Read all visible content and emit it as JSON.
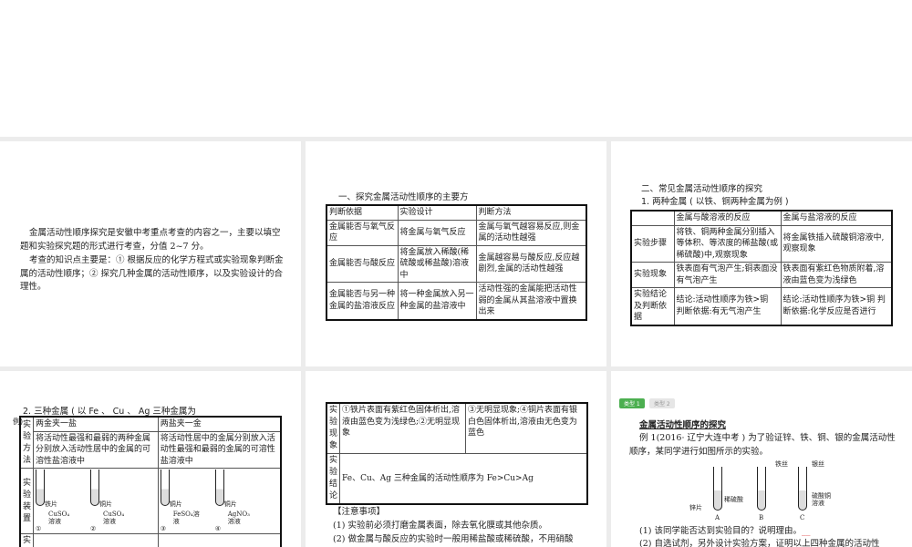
{
  "slide1": {
    "p1": "金属活动性顺序探究是安徽中考重点考查的内容之一，主要以填空题和实验探究题的形式进行考查，分值 2~7 分。",
    "p2": "考查的知识点主要是：① 根据反应的化学方程式或实验现象判断金属的活动性顺序；② 探究几种金属的活动性顺序，以及实验设计的合理性。"
  },
  "slide2": {
    "title": "一、探究金属活动性顺序的主要方",
    "headers": [
      "判断依据",
      "实验设计",
      "判断方法"
    ],
    "rows": [
      [
        "金属能否与氧气反应",
        "将金属与氧气反应",
        "金属与氧气越容易反应,则金属的活动性越强"
      ],
      [
        "金属能否与酸反应",
        "将金属放入稀酸(稀硫酸或稀盐酸)溶液中",
        "金属越容易与酸反应,反应越剧烈,金属的活动性越强"
      ],
      [
        "金属能否与另一种金属的盐溶液反应",
        "将一种金属放入另一种金属的盐溶液中",
        "活动性强的金属能把活动性弱的金属从其盐溶液中置换出来"
      ]
    ]
  },
  "slide3": {
    "title": "二、常见金属活动性顺序的探究",
    "subtitle": "1. 两种金属 ( 以铁、铜两种金属为例 )",
    "headers": [
      "",
      "金属与酸溶液的反应",
      "金属与盐溶液的反应"
    ],
    "rows": [
      [
        "实验步骤",
        "将铁、铜两种金属分别插入等体积、等浓度的稀盐酸(或稀硫酸)中,观察现象",
        "将金属铁插入硫酸铜溶液中,观察现象"
      ],
      [
        "实验现象",
        "铁表面有气泡产生;铜表面没有气泡产生",
        "铁表面有紫红色物质附着,溶液由蓝色变为浅绿色"
      ],
      [
        "实验结论及判断依据",
        "结论:活动性顺序为铁>铜 判断依据:有无气泡产生",
        "结论:活动性顺序为铁>铜 判断依据:化学反应是否进行"
      ]
    ]
  },
  "slide4": {
    "title": "2. 三种金属 ( 以 Fe 、 Cu 、 Ag 三种金属为",
    "title_cont": "例)",
    "method_label": "实验方法",
    "device_label": "实验装置",
    "result_label": "实",
    "col1_head": "两金夹一盐",
    "col2_head": "两盐夹一金",
    "col1_method": "将活动性最强和最弱的两种金属分别放入活动性居中的金属的可溶性盐溶液中",
    "col2_method": "将活动性居中的金属分别放入活动性最强和最弱的金属的可溶性盐溶液中",
    "tubes": [
      {
        "metal": "铁片",
        "solution": "CuSO₄溶液",
        "num": "①"
      },
      {
        "metal": "铜片",
        "solution": "CuSO₄溶液",
        "num": "②"
      },
      {
        "metal": "铜片",
        "solution": "FeSO₄溶液",
        "num": "③"
      },
      {
        "metal": "铜片",
        "solution": "AgNO₃溶液",
        "num": "④"
      }
    ]
  },
  "slide5": {
    "phen_label": "实验现象",
    "phen1": "①铁片表面有紫红色固体析出,溶液由蓝色变为浅绿色;②无明显现象",
    "phen2": "③无明显现象;④铜片表面有银白色固体析出,溶液由无色变为蓝色",
    "concl_label": "实验结论",
    "concl": "Fe、Cu、Ag 三种金属的活动性顺序为 Fe>Cu>Ag",
    "note_title": "【注意事项】",
    "note1": "(1) 实验前必须打磨金属表面，除去氧化膜或其他杂质。",
    "note2": "(2) 做金属与酸反应的实验时一般用稀盐酸或稀硫酸，不用硝酸"
  },
  "slide6": {
    "tab1": "类型 1",
    "tab2": "类型 2",
    "heading": "金属活动性顺序的探究",
    "example": "例 1(2016· 辽宁大连中考 ) 为了验证锌、铁、铜、银的金属活动性顺序，某同学进行如图所示的实验。",
    "labels": {
      "zinc": "锌片",
      "acid": "稀硫酸",
      "iron": "铁丝",
      "silver": "银丝",
      "cuso4": "硫酸铜溶液",
      "A": "A",
      "B": "B",
      "C": "C"
    },
    "q1": "(1) 该同学能否达到实验目的？说明理由。",
    "q1_blank": "__",
    "q2": "(2) 自选试剂，另外设计实验方案，证明以上四种金属的活动性"
  },
  "colors": {
    "tab_active": "#4caf50",
    "tab_inactive": "#e6e6e6"
  }
}
